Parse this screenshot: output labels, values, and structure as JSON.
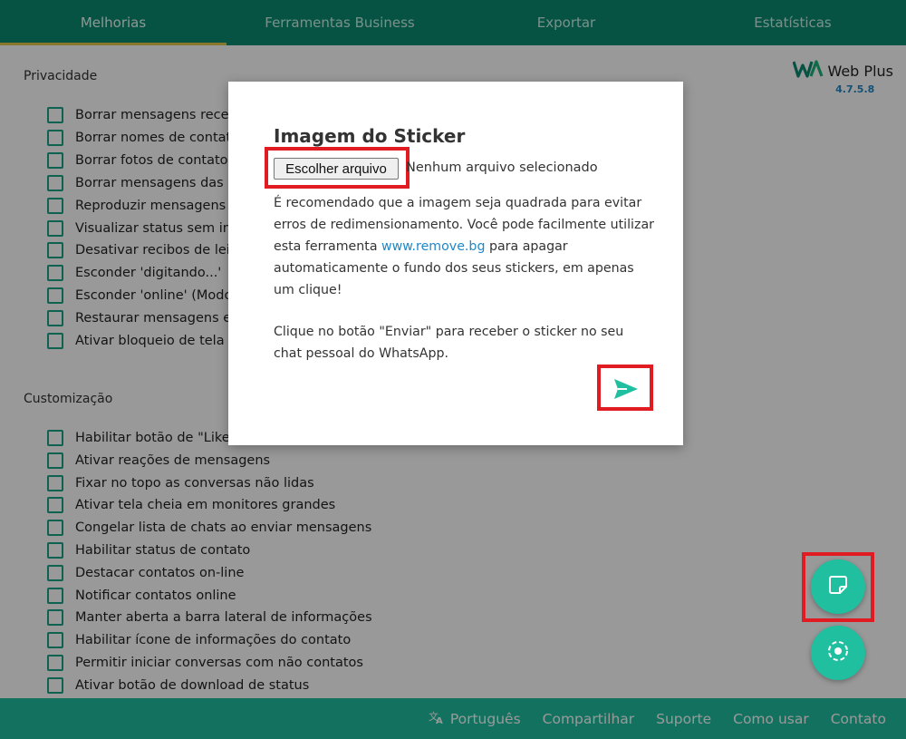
{
  "tabs": [
    "Melhorias",
    "Ferramentas Business",
    "Exportar",
    "Estatísticas"
  ],
  "active_tab": 0,
  "brand": {
    "name": "Web Plus",
    "version": "4.7.5.8"
  },
  "privacy": {
    "title": "Privacidade",
    "options": [
      "Borrar mensagens recen",
      "Borrar nomes de contato",
      "Borrar fotos de contatos",
      "Borrar mensagens das c",
      "Reproduzir mensagens d",
      "Visualizar status sem inf",
      "Desativar recibos de leit",
      "Esconder 'digitando...'",
      "Esconder 'online' (Modo",
      "Restaurar mensagens ex",
      "Ativar bloqueio de tela"
    ]
  },
  "custom": {
    "title": "Customização",
    "options": [
      "Habilitar botão de \"Like\"",
      "Ativar reações de mensagens",
      "Fixar no topo as conversas não lidas",
      "Ativar tela cheia em monitores grandes",
      "Congelar lista de chats ao enviar mensagens",
      "Habilitar status de contato",
      "Destacar contatos on-line",
      "Notificar contatos online",
      "Manter aberta a barra lateral de informações",
      "Habilitar ícone de informações do contato",
      "Permitir iniciar conversas com não contatos",
      "Ativar botão de download de status"
    ]
  },
  "modal": {
    "title": "Imagem do Sticker",
    "file_button": "Escolher arquivo",
    "file_status": "Nenhum arquivo selecionado",
    "desc_before": "É recomendado que a imagem seja quadrada para evitar erros de redimensionamento. Você pode facilmente utilizar esta ferramenta ",
    "desc_link": "www.remove.bg",
    "desc_after": " para apagar automaticamente o fundo dos seus stickers, em apenas um clique!",
    "desc2": "Clique no botão \"Enviar\" para receber o sticker no seu chat pessoal do WhatsApp."
  },
  "footer": {
    "language": "Português",
    "share": "Compartilhar",
    "support": "Suporte",
    "howto": "Como usar",
    "contact": "Contato"
  },
  "colors": {
    "header": "#0b8a72",
    "accent": "#1fbf9f",
    "active_underline": "#e7c64a",
    "highlight": "#e11b22",
    "link": "#1e88c8"
  }
}
